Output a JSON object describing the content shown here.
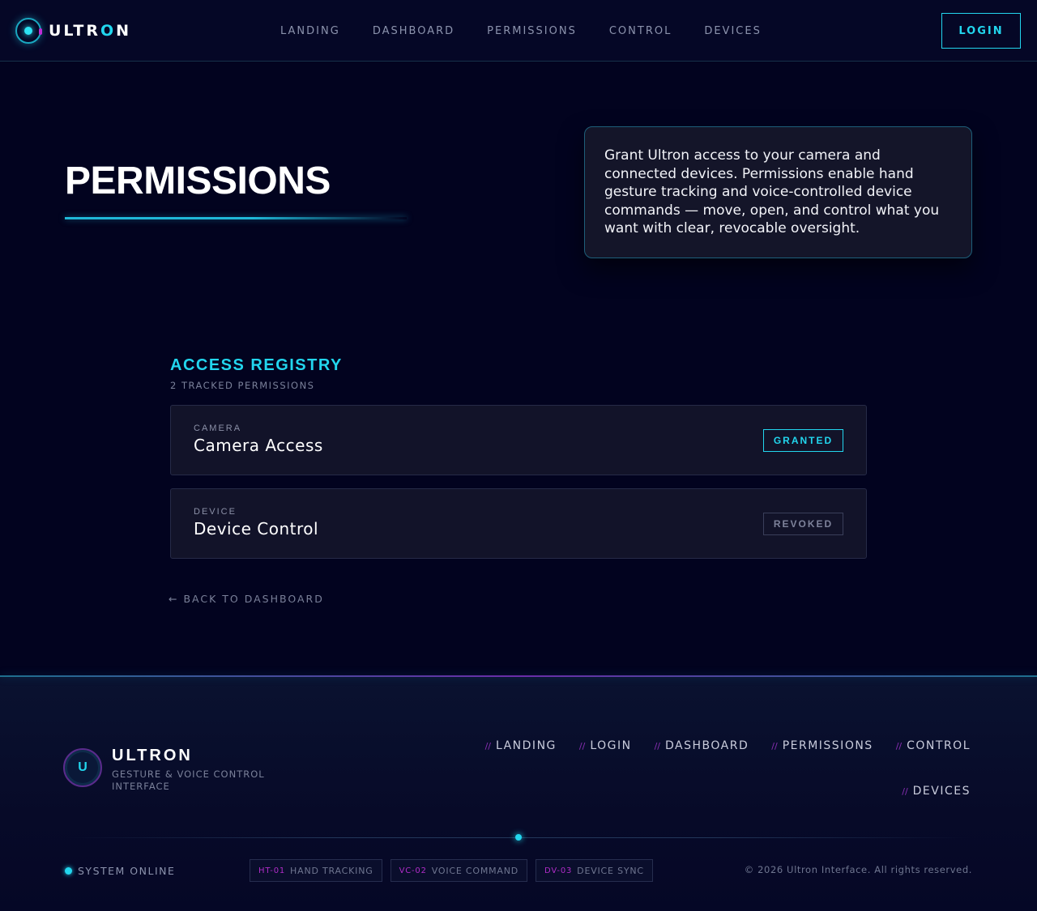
{
  "header": {
    "brand_prefix": "ULTR",
    "brand_accent": "O",
    "brand_suffix": "N",
    "nav": [
      "LANDING",
      "DASHBOARD",
      "PERMISSIONS",
      "CONTROL",
      "DEVICES"
    ],
    "login_label": "LOGIN"
  },
  "hero": {
    "title": "PERMISSIONS",
    "intro": "Grant Ultron access to your camera and connected devices. Permissions enable hand gesture tracking and voice-controlled device commands — move, open, and control what you want with clear, revocable oversight."
  },
  "registry": {
    "heading": "ACCESS REGISTRY",
    "count": "2 TRACKED PERMISSIONS",
    "items": [
      {
        "category": "CAMERA",
        "name": "Camera Access",
        "status": "GRANTED"
      },
      {
        "category": "DEVICE",
        "name": "Device Control",
        "status": "REVOKED"
      }
    ],
    "back_link": "← BACK TO DASHBOARD"
  },
  "footer": {
    "logo_letter": "U",
    "brand": "ULTRON",
    "tagline": "GESTURE & VOICE CONTROL INTERFACE",
    "link_prefix": "//",
    "links": [
      "LANDING",
      "LOGIN",
      "DASHBOARD",
      "PERMISSIONS",
      "CONTROL",
      "DEVICES"
    ],
    "system_status": "SYSTEM ONLINE",
    "badges": [
      {
        "code": "HT-01",
        "label": "HAND TRACKING"
      },
      {
        "code": "VC-02",
        "label": "VOICE COMMAND"
      },
      {
        "code": "DV-03",
        "label": "DEVICE SYNC"
      }
    ],
    "copyright": "© 2026 Ultron Interface. All rights reserved."
  },
  "colors": {
    "background": "#02031f",
    "accent_cyan": "#22d6ee",
    "accent_magenta": "#b02cc8",
    "card": "#141529"
  }
}
